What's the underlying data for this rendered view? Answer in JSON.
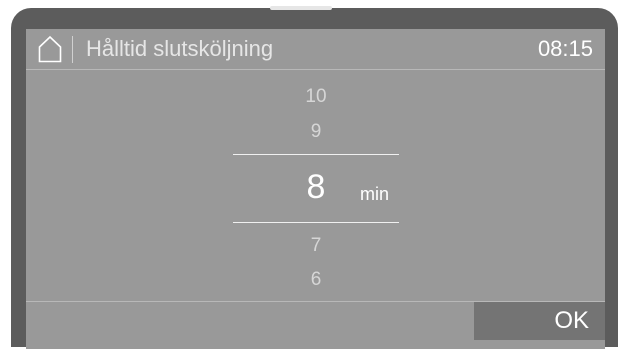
{
  "header": {
    "title": "Hålltid slutsköljning",
    "clock": "08:15",
    "home_icon": "home-icon"
  },
  "picker": {
    "values_above": [
      "10",
      "9"
    ],
    "selected": "8",
    "unit": "min",
    "values_below": [
      "7",
      "6"
    ]
  },
  "footer": {
    "ok_label": "OK"
  },
  "colors": {
    "screen_bg": "#999999",
    "bezel": "#5c5c5c",
    "ok_button_bg": "#747474",
    "text_primary": "#ffffff"
  }
}
